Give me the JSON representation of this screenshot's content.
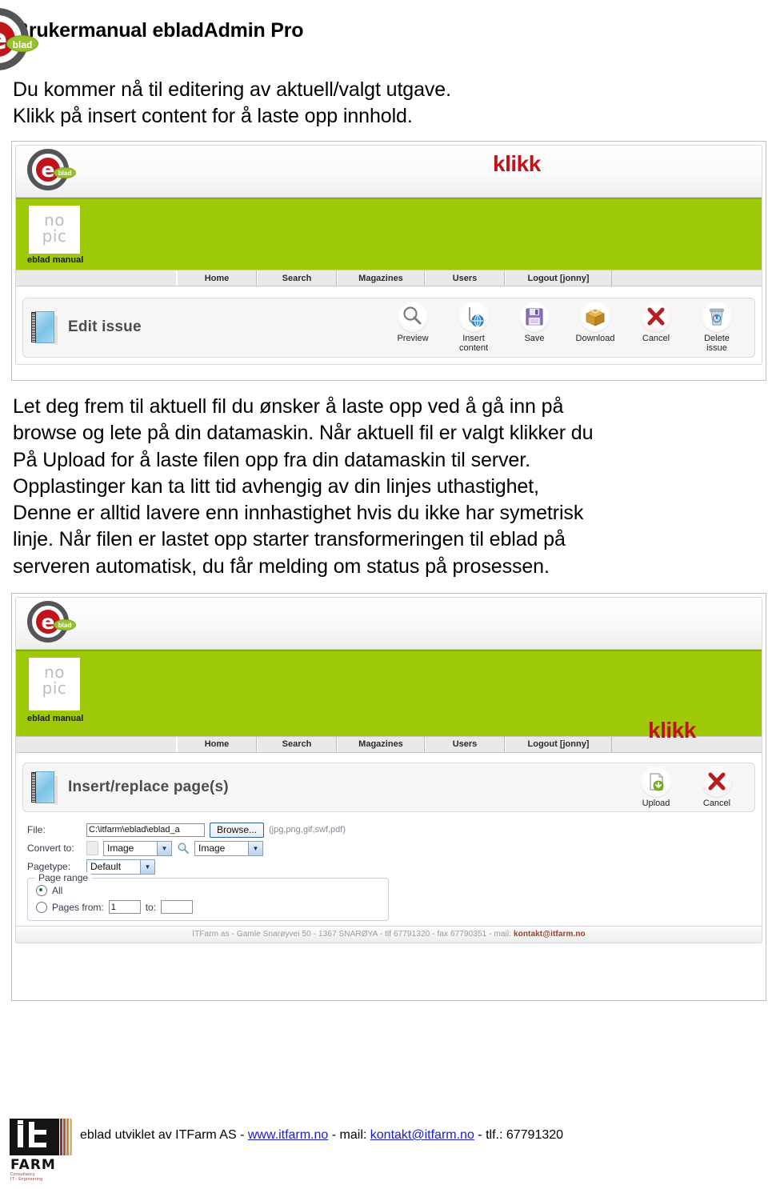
{
  "header": {
    "title": "Brukermanual ebladAdmin Pro",
    "logo_letter": "e",
    "logo_badge": "blad"
  },
  "intro": {
    "line1": "Du kommer nå til editering av aktuell/valgt utgave.",
    "line2": "Klikk på insert content for å laste opp innhold."
  },
  "screenshot1": {
    "magazine_placeholder_line1": "no",
    "magazine_placeholder_line2": "pic",
    "magazine_label": "eblad manual",
    "nav": [
      {
        "label": "Home"
      },
      {
        "label": "Search"
      },
      {
        "label": "Magazines"
      },
      {
        "label": "Users"
      },
      {
        "label": "Logout [jonny]"
      }
    ],
    "panel_title": "Edit issue",
    "annotation": "klikk",
    "toolbar": [
      {
        "label": "Preview",
        "icon": "magnifier-icon"
      },
      {
        "label": "Insert\ncontent",
        "label_line1": "Insert",
        "label_line2": "content",
        "icon": "insert-content-icon"
      },
      {
        "label": "Save",
        "icon": "floppy-disk-icon"
      },
      {
        "label": "Download",
        "icon": "package-box-icon"
      },
      {
        "label": "Cancel",
        "icon": "red-x-icon"
      },
      {
        "label": "Delete issue",
        "label_line1": "Delete",
        "label_line2": "issue",
        "icon": "trash-can-icon"
      }
    ]
  },
  "middle": {
    "line1": "Let deg frem til aktuell fil du ønsker å laste opp ved å gå inn på",
    "line2": "browse og lete på din datamaskin. Når aktuell fil er valgt klikker du",
    "line3": "På Upload for å laste filen opp fra din datamaskin til server.",
    "line4": "Opplastinger kan ta litt tid avhengig av din linjes uthastighet,",
    "line5": "Denne er alltid lavere enn innhastighet hvis du ikke har symetrisk",
    "line6": "linje. Når filen er lastet opp starter transformeringen til eblad på",
    "line7": "serveren automatisk, du får melding om status på prosessen."
  },
  "screenshot2": {
    "magazine_placeholder_line1": "no",
    "magazine_placeholder_line2": "pic",
    "magazine_label": "eblad manual",
    "nav": [
      {
        "label": "Home"
      },
      {
        "label": "Search"
      },
      {
        "label": "Magazines"
      },
      {
        "label": "Users"
      },
      {
        "label": "Logout [jonny]"
      }
    ],
    "panel_title": "Insert/replace page(s)",
    "annotation": "klikk",
    "toolbar": [
      {
        "label": "Upload",
        "icon": "upload-icon"
      },
      {
        "label": "Cancel",
        "icon": "red-x-icon"
      }
    ],
    "form": {
      "file_label": "File:",
      "file_value": "C:\\itfarm\\eblad\\eblad_a",
      "browse_label": "Browse...",
      "file_hint": "(jpg,png,gif,swf,pdf)",
      "convert_label": "Convert to:",
      "convert_option_1": "Image",
      "convert_option_2": "Image",
      "pagetype_label": "Pagetype:",
      "pagetype_value": "Default",
      "page_range_legend": "Page range",
      "radio_all_label": "All",
      "radio_pages_label": "Pages from:",
      "pages_from_value": "1",
      "pages_to_label": "to:",
      "pages_to_value": ""
    },
    "footer_prefix": "ITFarm as - Gamle Snarøyvei 50 - 1367 SNARØYA - tlf 67791320 - fax 67790351 - mail: ",
    "footer_mail": "kontakt@itfarm.no"
  },
  "footer": {
    "logo_farm": "FARM",
    "logo_tagline_line1": "Consultancy",
    "logo_tagline_line2": "IT - Engineering",
    "text_prefix": "eblad utviklet av ITFarm AS - ",
    "link_www": "www.itfarm.no",
    "text_mid": " - mail: ",
    "link_mail": "kontakt@itfarm.no",
    "text_suffix": " - tlf.: 67791320"
  },
  "colors": {
    "green_banner": "#9dc908",
    "brand_red": "#c0141b",
    "badge_green": "#97c22e",
    "annotation_red": "#c0121b",
    "link_blue": "#1a1ad0"
  }
}
